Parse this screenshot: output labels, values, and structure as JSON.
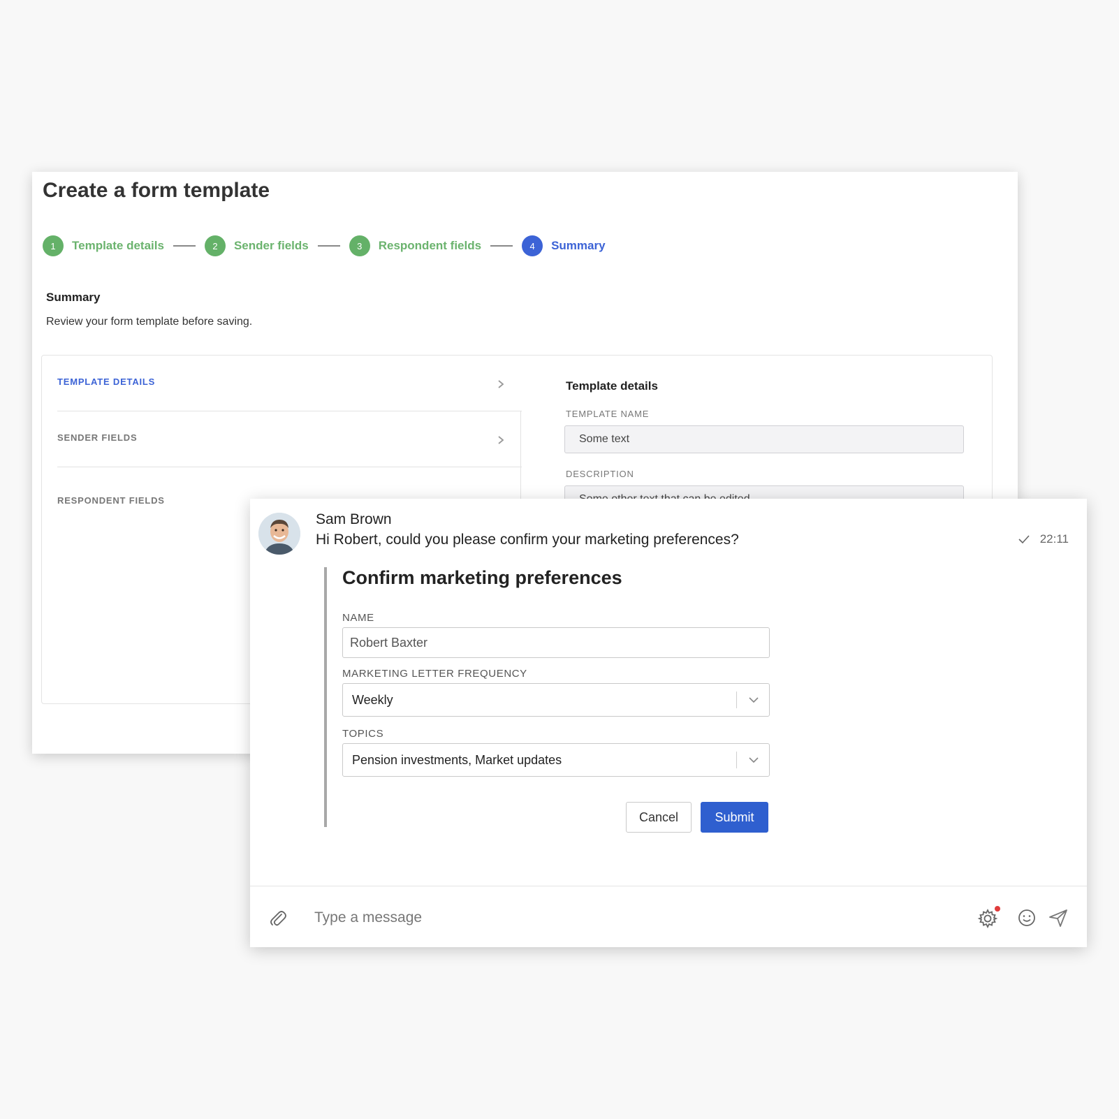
{
  "builder": {
    "title": "Create a form template",
    "steps": [
      {
        "num": "1",
        "label": "Template details"
      },
      {
        "num": "2",
        "label": "Sender fields"
      },
      {
        "num": "3",
        "label": "Respondent fields"
      },
      {
        "num": "4",
        "label": "Summary"
      }
    ],
    "section_title": "Summary",
    "section_subtitle": "Review your form template before saving.",
    "nav": [
      {
        "label": "TEMPLATE DETAILS"
      },
      {
        "label": "SENDER FIELDS"
      },
      {
        "label": "RESPONDENT FIELDS"
      }
    ],
    "details": {
      "title": "Template details",
      "name_label": "TEMPLATE NAME",
      "name_value": "Some text",
      "description_label": "DESCRIPTION",
      "description_value": "Some other text that can be edited"
    }
  },
  "chat": {
    "sender": "Sam Brown",
    "message": "Hi Robert, could you please confirm your marketing preferences?",
    "time": "22:11",
    "form": {
      "title": "Confirm marketing preferences",
      "name_label": "NAME",
      "name_value": "Robert Baxter",
      "frequency_label": "MARKETING LETTER FREQUENCY",
      "frequency_value": "Weekly",
      "topics_label": "TOPICS",
      "topics_value": "Pension investments, Market updates",
      "cancel_label": "Cancel",
      "submit_label": "Submit"
    },
    "composer": {
      "placeholder": "Type a message"
    }
  },
  "colors": {
    "step_done": "#64b168",
    "step_active": "#3c63d6",
    "submit": "#2f5fcf",
    "notification_dot": "#e03b3b"
  }
}
